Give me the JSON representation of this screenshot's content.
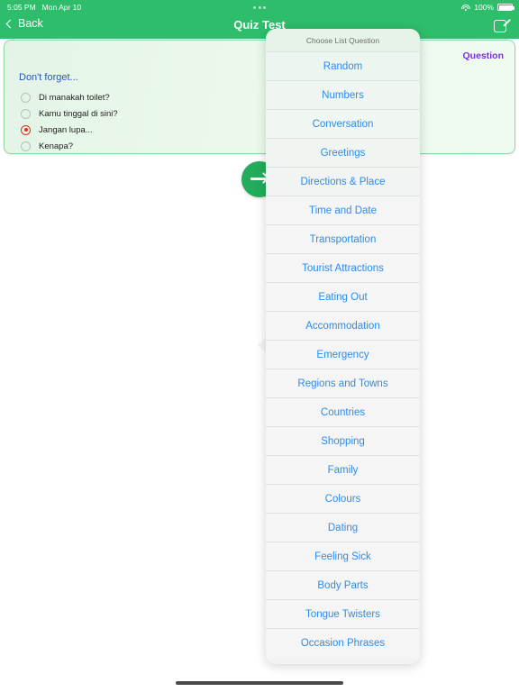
{
  "status_bar": {
    "time": "5:05 PM",
    "date": "Mon Apr 10",
    "multitask_dots": "•••",
    "battery_percent": "100%",
    "wifi_icon": "wifi-icon",
    "battery_icon": "battery-full-icon"
  },
  "nav_bar": {
    "back_label": "Back",
    "title": "Quiz Test",
    "back_icon": "chevron-left-icon",
    "compose_icon": "compose-icon",
    "background_color": "#2ebd6b"
  },
  "quiz_card": {
    "question_label": "Question",
    "question_label_color": "#7b2fe0",
    "prompt": "Don't forget...",
    "prompt_color": "#2255cc",
    "selected_index": 2,
    "selected_color": "#e0301e",
    "options": [
      {
        "label": "Di manakah toilet?",
        "selected": false
      },
      {
        "label": "Kamu tinggal di sini?",
        "selected": false
      },
      {
        "label": "Jangan lupa...",
        "selected": true
      },
      {
        "label": "Kenapa?",
        "selected": false
      }
    ]
  },
  "next_button": {
    "icon": "arrow-right-icon",
    "color": "#22ac5c"
  },
  "popover": {
    "header": "Choose List Question",
    "item_color": "#2b8cf0",
    "items": [
      {
        "label": "Random"
      },
      {
        "label": "Numbers"
      },
      {
        "label": "Conversation"
      },
      {
        "label": "Greetings"
      },
      {
        "label": "Directions & Place"
      },
      {
        "label": "Time and Date"
      },
      {
        "label": "Transportation"
      },
      {
        "label": "Tourist Attractions"
      },
      {
        "label": "Eating Out"
      },
      {
        "label": "Accommodation"
      },
      {
        "label": "Emergency"
      },
      {
        "label": "Regions and Towns"
      },
      {
        "label": "Countries"
      },
      {
        "label": "Shopping"
      },
      {
        "label": "Family"
      },
      {
        "label": "Colours"
      },
      {
        "label": "Dating"
      },
      {
        "label": "Feeling Sick"
      },
      {
        "label": "Body Parts"
      },
      {
        "label": "Tongue Twisters"
      },
      {
        "label": "Occasion Phrases"
      }
    ]
  }
}
